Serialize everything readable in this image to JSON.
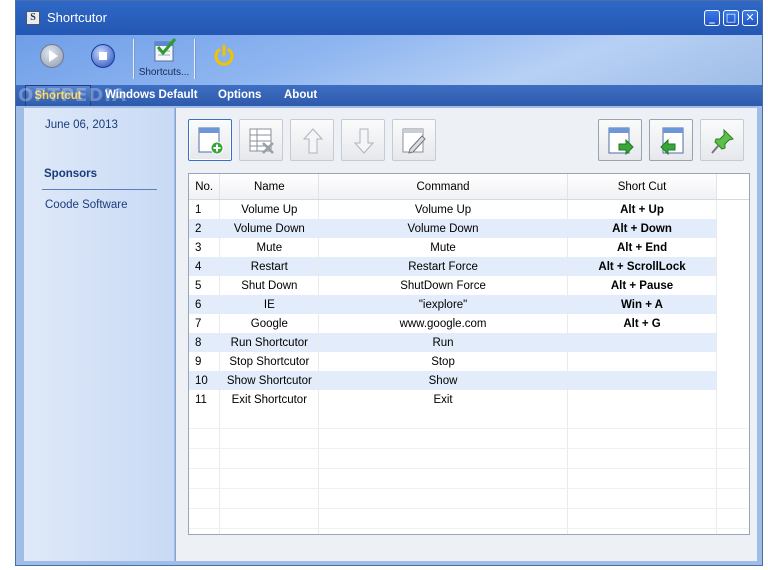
{
  "window": {
    "title": "Shortcutor",
    "icon_letter": "S",
    "controls": {
      "minimize": "_",
      "maximize": "□",
      "close": "✕"
    }
  },
  "toolbar": {
    "play_icon": "play-icon",
    "stop_icon": "stop-icon",
    "shortcuts_label": "Shortcuts...",
    "power_icon": "power-icon"
  },
  "tabs": [
    "Shortcut",
    "Windows Default",
    "Options",
    "About"
  ],
  "active_tab": "Shortcut",
  "watermark": "SOFTPEDIA",
  "sidebar": {
    "date": "June 06, 2013",
    "sponsors_heading": "Sponsors",
    "sponsor_link": "Coode Software"
  },
  "actions": [
    "add-icon",
    "delete-icon",
    "move-up-icon",
    "move-down-icon",
    "edit-icon",
    "export-icon",
    "import-icon",
    "pin-icon"
  ],
  "table": {
    "columns": [
      "No.",
      "Name",
      "Command",
      "Short Cut"
    ],
    "rows": [
      [
        "1",
        "Volume Up",
        "Volume Up",
        "Alt + Up"
      ],
      [
        "2",
        "Volume Down",
        "Volume Down",
        "Alt + Down"
      ],
      [
        "3",
        "Mute",
        "Mute",
        "Alt + End"
      ],
      [
        "4",
        "Restart",
        "Restart Force",
        "Alt + ScrollLock"
      ],
      [
        "5",
        "Shut Down",
        "ShutDown Force",
        "Alt + Pause"
      ],
      [
        "6",
        "IE",
        "\"iexplore\"",
        "Win + A"
      ],
      [
        "7",
        "Google",
        "www.google.com",
        "Alt + G"
      ],
      [
        "8",
        "Run Shortcutor",
        "Run",
        ""
      ],
      [
        "9",
        "Stop Shortcutor",
        "Stop",
        ""
      ],
      [
        "10",
        "Show Shortcutor",
        "Show",
        ""
      ],
      [
        "11",
        "Exit Shortcutor",
        "Exit",
        ""
      ]
    ],
    "empty_rows": 7
  },
  "colors": {
    "titlebar": "#2457b4",
    "active_tab_text": "#ffd34a",
    "row_highlight": "#e2ecfa"
  }
}
